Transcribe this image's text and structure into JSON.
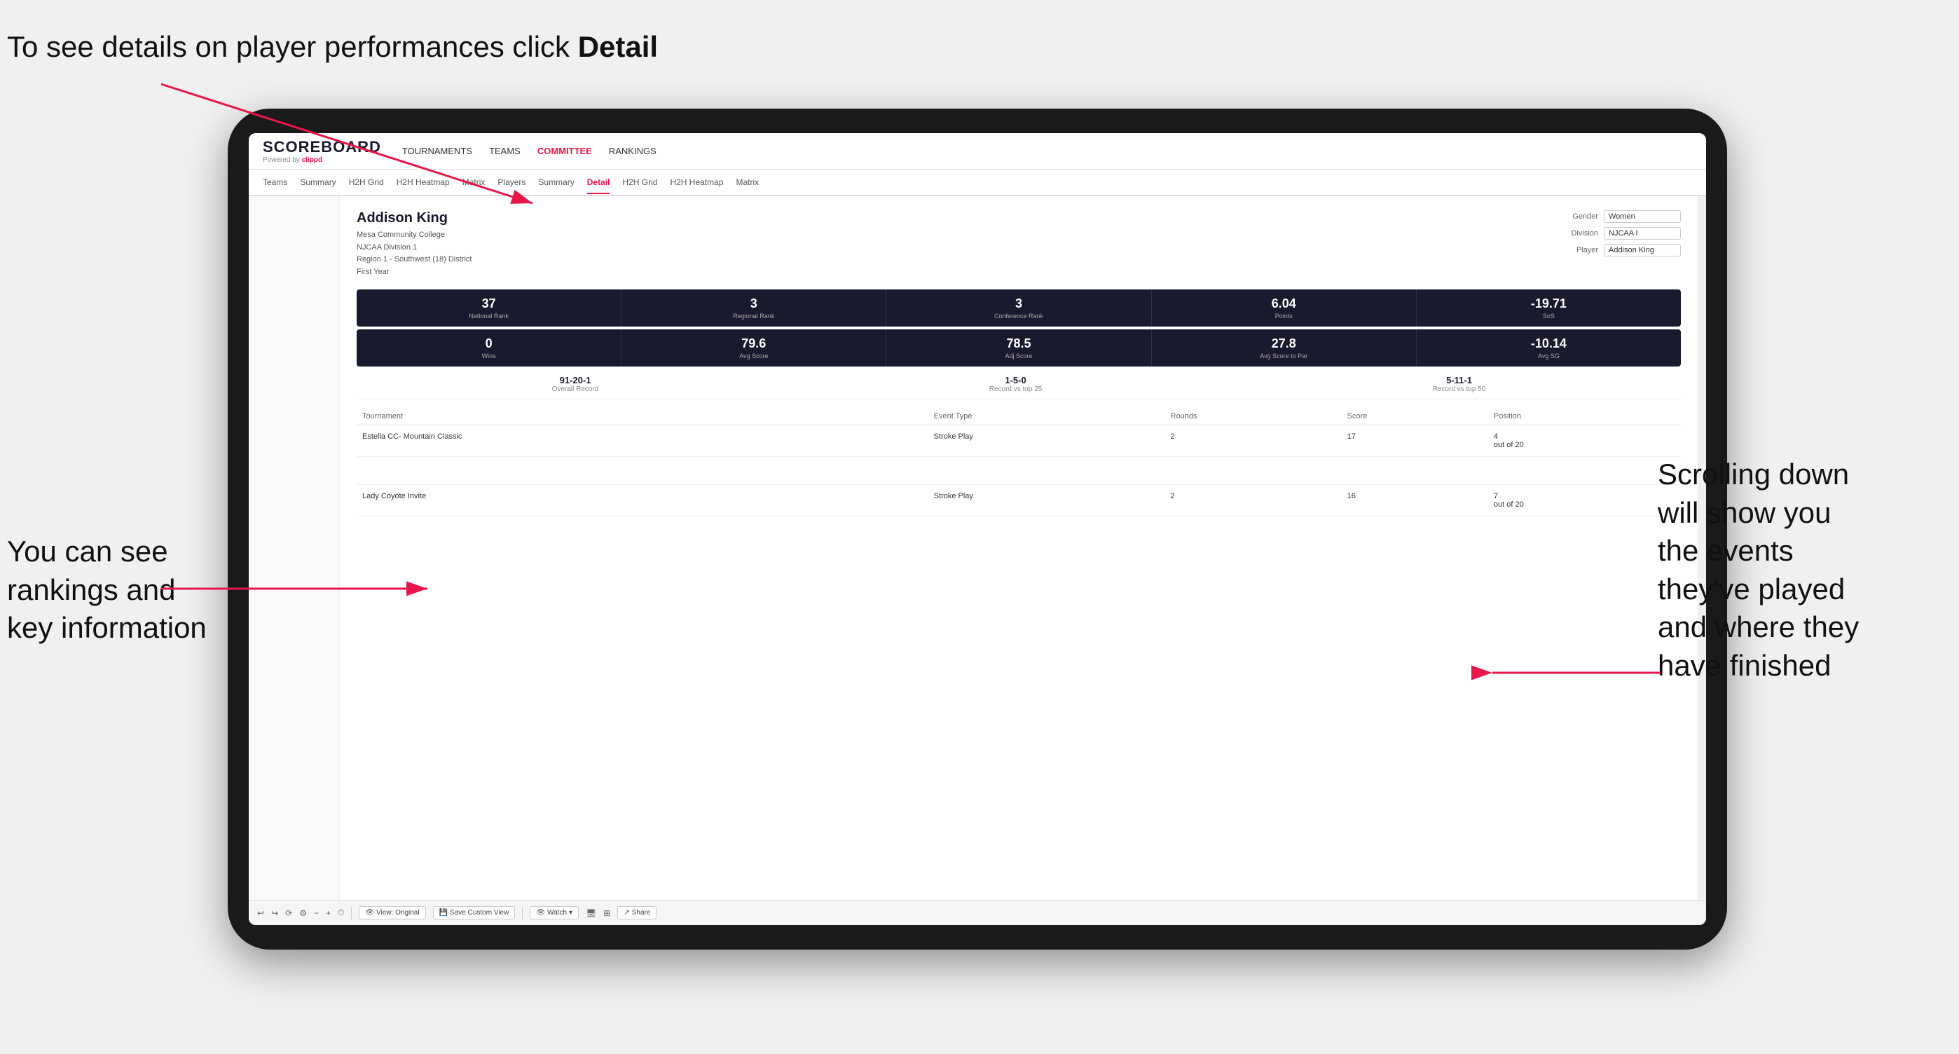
{
  "annotations": {
    "top_left": "To see details on\nplayer performances\nclick ",
    "top_left_bold": "Detail",
    "bottom_left_line1": "You can see",
    "bottom_left_line2": "rankings and",
    "bottom_left_line3": "key information",
    "right_line1": "Scrolling down",
    "right_line2": "will show you",
    "right_line3": "the events",
    "right_line4": "they've played",
    "right_line5": "and where they",
    "right_line6": "have finished"
  },
  "nav": {
    "logo": "SCOREBOARD",
    "powered_by": "Powered by ",
    "clippd": "clippd",
    "links": [
      {
        "label": "TOURNAMENTS",
        "active": false
      },
      {
        "label": "TEAMS",
        "active": false
      },
      {
        "label": "COMMITTEE",
        "active": true
      },
      {
        "label": "RANKINGS",
        "active": false
      }
    ]
  },
  "sub_tabs": [
    {
      "label": "Teams",
      "active": false
    },
    {
      "label": "Summary",
      "active": false
    },
    {
      "label": "H2H Grid",
      "active": false
    },
    {
      "label": "H2H Heatmap",
      "active": false
    },
    {
      "label": "Matrix",
      "active": false
    },
    {
      "label": "Players",
      "active": false
    },
    {
      "label": "Summary",
      "active": false
    },
    {
      "label": "Detail",
      "active": true
    },
    {
      "label": "H2H Grid",
      "active": false
    },
    {
      "label": "H2H Heatmap",
      "active": false
    },
    {
      "label": "Matrix",
      "active": false
    }
  ],
  "player": {
    "name": "Addison King",
    "college": "Mesa Community College",
    "division": "NJCAA Division 1",
    "region": "Region 1 - Southwest (18) District",
    "year": "First Year"
  },
  "controls": {
    "gender_label": "Gender",
    "gender_value": "Women",
    "division_label": "Division",
    "division_value": "NJCAA I",
    "player_label": "Player",
    "player_value": "Addison King"
  },
  "stats_row1": [
    {
      "value": "37",
      "label": "National Rank"
    },
    {
      "value": "3",
      "label": "Regional Rank"
    },
    {
      "value": "3",
      "label": "Conference Rank"
    },
    {
      "value": "6.04",
      "label": "Points"
    },
    {
      "value": "-19.71",
      "label": "SoS"
    }
  ],
  "stats_row2": [
    {
      "value": "0",
      "label": "Wins"
    },
    {
      "value": "79.6",
      "label": "Avg Score"
    },
    {
      "value": "78.5",
      "label": "Adj Score"
    },
    {
      "value": "27.8",
      "label": "Avg Score to Par"
    },
    {
      "value": "-10.14",
      "label": "Avg SG"
    }
  ],
  "records": [
    {
      "value": "91-20-1",
      "label": "Overall Record"
    },
    {
      "value": "1-5-0",
      "label": "Record vs top 25"
    },
    {
      "value": "5-11-1",
      "label": "Record vs top 50"
    }
  ],
  "table": {
    "headers": [
      "Tournament",
      "",
      "Event Type",
      "Rounds",
      "Score",
      "Position"
    ],
    "rows": [
      {
        "tournament": "Estella CC- Mountain Classic",
        "event_type": "Stroke Play",
        "rounds": "2",
        "score": "17",
        "position": "4\nout of 20"
      },
      {
        "tournament": "",
        "event_type": "",
        "rounds": "",
        "score": "",
        "position": ""
      },
      {
        "tournament": "Lady Coyote Invite",
        "event_type": "Stroke Play",
        "rounds": "2",
        "score": "16",
        "position": "7\nout of 20"
      }
    ]
  },
  "toolbar": {
    "view_label": "View: Original",
    "save_label": "Save Custom View",
    "watch_label": "Watch",
    "share_label": "Share"
  }
}
